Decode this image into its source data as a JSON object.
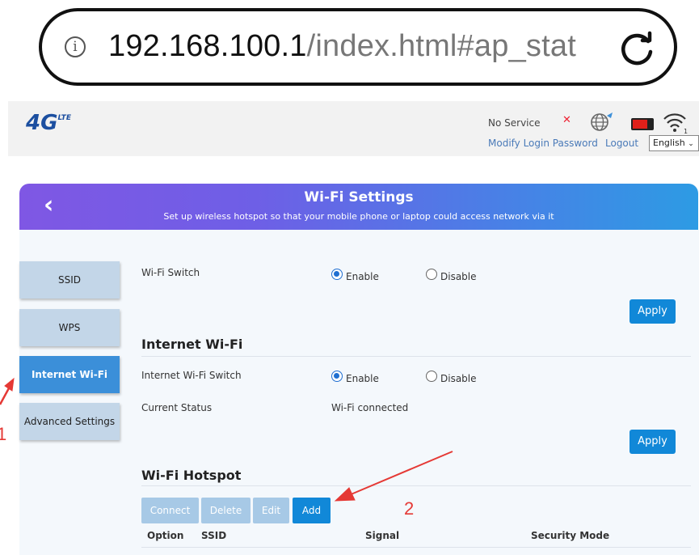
{
  "browser": {
    "url_host": "192.168.100.1",
    "url_path": "/index.html#ap_stat"
  },
  "header": {
    "logo": "4G",
    "logo_sub": "LTE",
    "status": "No Service",
    "modify_password": "Modify Login Password",
    "logout": "Logout",
    "language": "English"
  },
  "banner": {
    "title": "Wi-Fi Settings",
    "subtitle": "Set up wireless hotspot so that your mobile phone or laptop could access network via it"
  },
  "sidebar": {
    "items": [
      {
        "label": "SSID"
      },
      {
        "label": "WPS"
      },
      {
        "label": "Internet Wi-Fi"
      },
      {
        "label": "Advanced Settings"
      }
    ]
  },
  "wifi_switch": {
    "label": "Wi-Fi Switch",
    "enable": "Enable",
    "disable": "Disable",
    "selected": "Enable",
    "apply": "Apply"
  },
  "internet_wifi": {
    "title": "Internet Wi-Fi",
    "switch_label": "Internet Wi-Fi Switch",
    "enable": "Enable",
    "disable": "Disable",
    "selected": "Enable",
    "status_label": "Current Status",
    "status_value": "Wi-Fi connected",
    "apply": "Apply"
  },
  "hotspot": {
    "title": "Wi-Fi Hotspot",
    "buttons": {
      "connect": "Connect",
      "delete": "Delete",
      "edit": "Edit",
      "add": "Add"
    },
    "columns": [
      "Option",
      "SSID",
      "Signal",
      "Security Mode"
    ]
  },
  "annotations": {
    "step1": "1",
    "step2": "2"
  },
  "colors": {
    "accent": "#1188d8",
    "annotation": "#e53935",
    "sidebar_active": "#3b8fd9",
    "sidebar_inactive": "#c3d6e8"
  }
}
